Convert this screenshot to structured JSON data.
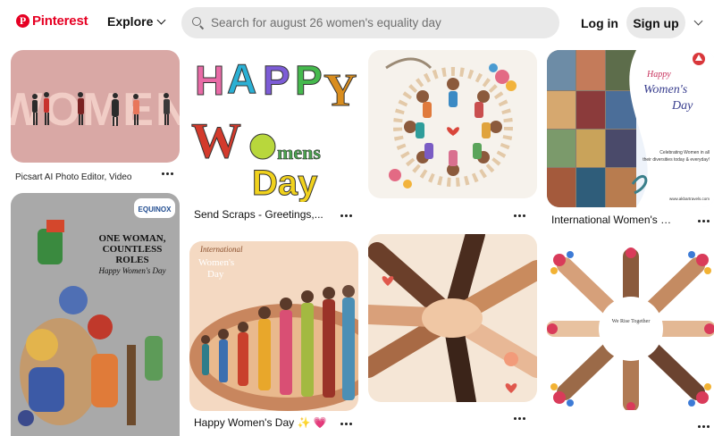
{
  "header": {
    "logo_text": "Pinterest",
    "logo_icon": "pinterest-logo-icon",
    "explore_label": "Explore",
    "search_placeholder": "Search for august 26 women's equality day",
    "login_label": "Log in",
    "signup_label": "Sign up"
  },
  "colors": {
    "brand": "#e60023",
    "search_bg": "#e9e9e9"
  },
  "pins": [
    {
      "caption": "Picsart AI Photo Editor, Video",
      "image_text": "WOMEN"
    },
    {
      "caption": "",
      "image_text_1": "ONE WOMAN, COUNTLESS ROLES",
      "image_text_2": "Happy Women's Day",
      "badge": "EQUINOX"
    },
    {
      "caption": "Send Scraps - Greetings,...",
      "image_text_1": "HAPPY",
      "image_text_2": "Womens",
      "image_text_3": "Day"
    },
    {
      "caption": "Happy Women's Day ✨ 💗",
      "image_text_1": "International",
      "image_text_2": "Women's",
      "image_text_3": "Day"
    },
    {
      "caption": ""
    },
    {
      "caption": ""
    },
    {
      "caption": "International Women's Day...",
      "image_text_1": "Happy",
      "image_text_2": "Women's",
      "image_text_3": "Day",
      "image_text_4": "Celebrating Women in all their diversities today & everyday!",
      "image_text_5": "www.akbartravels.com"
    },
    {
      "caption": "",
      "image_text": "We Rise Together"
    }
  ]
}
